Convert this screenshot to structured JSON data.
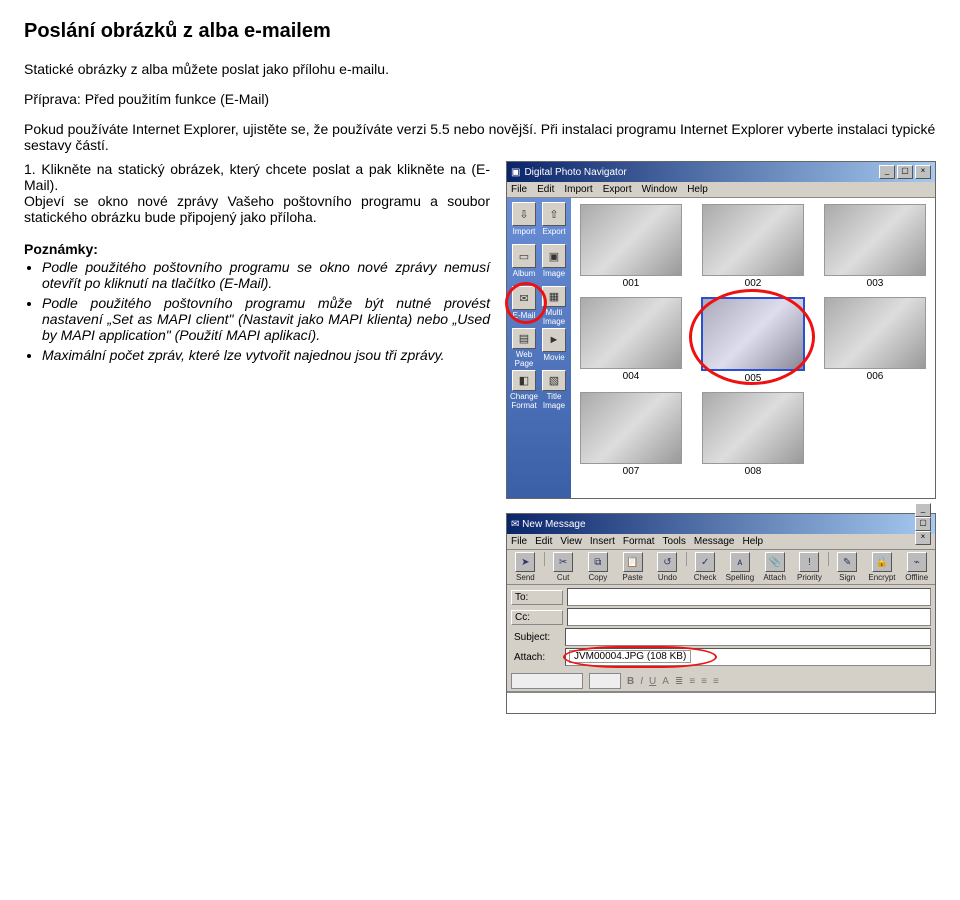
{
  "doc": {
    "title": "Poslání obrázků z alba e-mailem",
    "intro": "Statické obrázky z alba můžete poslat jako přílohu e-mailu.",
    "prep_label": "Příprava:",
    "prep_text": " Před použitím funkce (E-Mail)",
    "prep_para": "Pokud používáte Internet Explorer, ujistěte se, že používáte verzi 5.5 nebo novější. Při instalaci programu Internet Explorer vyberte instalaci typické sestavy částí.",
    "step1_num": "1.",
    "step1a": "Klikněte na statický obrázek, který chcete poslat a pak klikněte na (E-Mail).",
    "step1b": "Objeví se okno nové zprávy Vašeho poštovního programu a soubor statického obrázku bude připojený jako příloha.",
    "notes_label": "Poznámky:",
    "note1": "Podle použitého poštovního programu se okno nové zprávy nemusí otevřít po kliknutí na tlačítko (E-Mail).",
    "note2": "Podle použitého poštovního programu může být nutné provést nastavení „Set as MAPI client\" (Nastavit jako MAPI klienta) nebo „Used by MAPI application\" (Použití MAPI aplikací).",
    "note3": "Maximální počet zpráv, které lze vytvořit najednou jsou tři zprávy."
  },
  "dpn": {
    "title": "Digital Photo Navigator",
    "menu": [
      "File",
      "Edit",
      "Import",
      "Export",
      "Window",
      "Help"
    ],
    "tools": {
      "import": "Import",
      "export": "Export",
      "album": "Album",
      "image": "Image",
      "email": "E-Mail",
      "multi": "Multi Image",
      "web": "Web Page",
      "movie": "Movie",
      "change": "Change Format",
      "titleimg": "Title Image"
    },
    "thumbs": [
      "001",
      "002",
      "003",
      "004",
      "005",
      "006",
      "007",
      "008"
    ]
  },
  "nm": {
    "title": "New Message",
    "menu": [
      "File",
      "Edit",
      "View",
      "Insert",
      "Format",
      "Tools",
      "Message",
      "Help"
    ],
    "toolbar": [
      "Send",
      "Cut",
      "Copy",
      "Paste",
      "Undo",
      "Check",
      "Spelling",
      "Attach",
      "Priority",
      "Sign",
      "Encrypt",
      "Offline"
    ],
    "labels": {
      "to": "To:",
      "cc": "Cc:",
      "subject": "Subject:",
      "attach": "Attach:"
    },
    "attach_value": "JVM00004.JPG (108 KB)"
  }
}
